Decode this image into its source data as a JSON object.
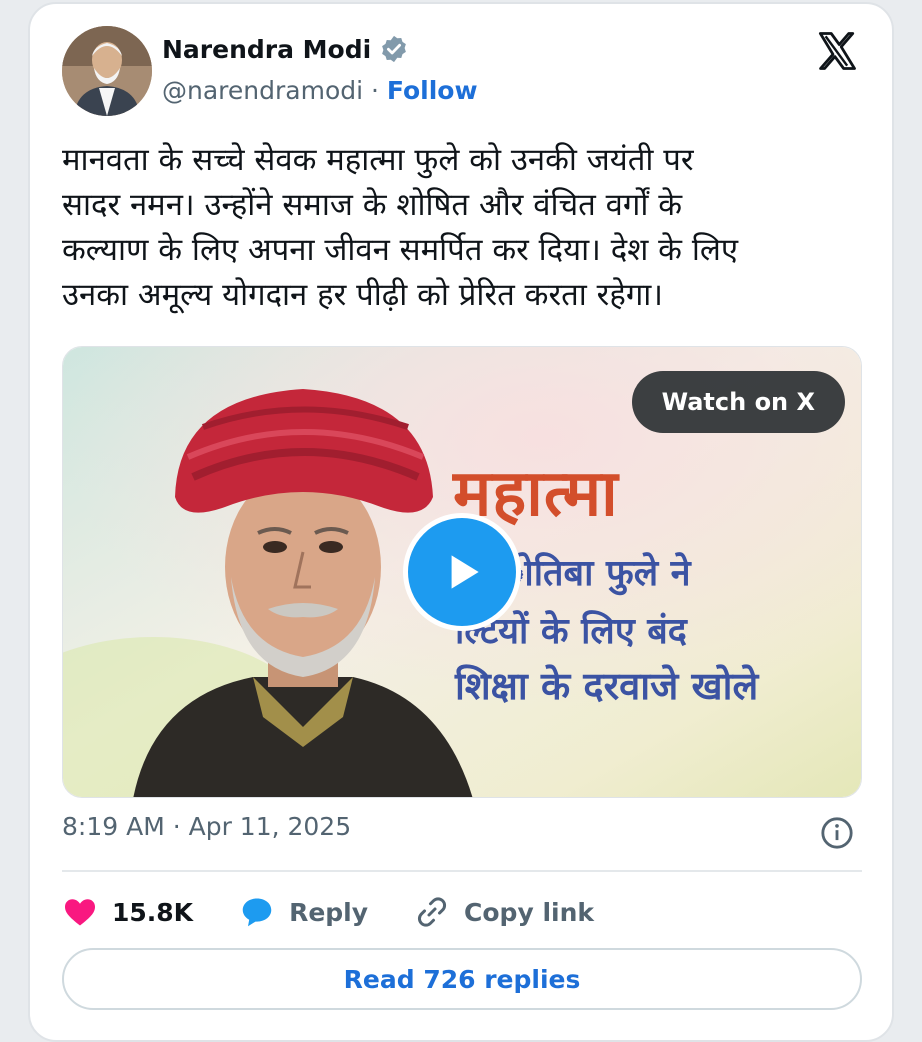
{
  "author": {
    "name": "Narendra Modi",
    "handle": "@narendramodi",
    "separator": " · ",
    "follow_label": "Follow"
  },
  "tweet": {
    "lines": [
      "मानवता के सच्चे सेवक महात्मा फुले को उनकी जयंती पर",
      "सादर नमन। उन्होंने समाज के शोषित और वंचित वर्गों के",
      "कल्याण के लिए अपना जीवन समर्पित कर दिया। देश के लिए",
      "उनका अमूल्य योगदान हर पीढ़ी को प्रेरित करता रहेगा।"
    ]
  },
  "media": {
    "watch_label": "Watch on X",
    "headline_1": "महात्मा",
    "headline_2": "ोतिबा फुले ने",
    "headline_3": "ल्टियों के लिए बंद",
    "headline_4": "शिक्षा के दरवाजे खोले"
  },
  "meta": {
    "timestamp": "8:19 AM · Apr 11, 2025"
  },
  "actions": {
    "like_count": "15.8K",
    "reply_label": "Reply",
    "copy_label": "Copy link"
  },
  "read_replies_label": "Read 726 replies",
  "colors": {
    "accent": "#1d6fd8",
    "like": "#f91880",
    "reply": "#1d9bf0",
    "turban": "#c4273a"
  },
  "icons": [
    "verified-badge-icon",
    "x-logo-icon",
    "play-icon",
    "info-icon",
    "heart-icon",
    "reply-bubble-icon",
    "link-icon"
  ]
}
